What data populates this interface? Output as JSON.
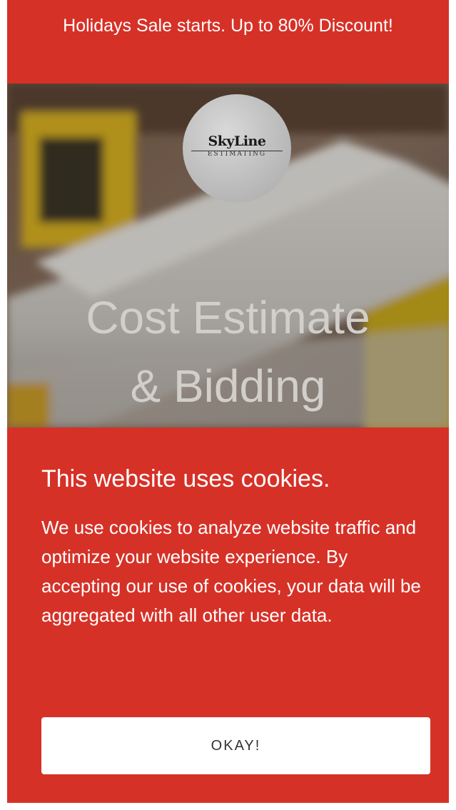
{
  "announcement": {
    "text": "Holidays Sale starts. Up to 80% Discount!"
  },
  "hero": {
    "logo": {
      "name": "SkyLine",
      "sub": "ESTIMATING"
    },
    "title_line1": "Cost Estimate",
    "title_line2": "& Bidding"
  },
  "cookie_banner": {
    "heading": "This website uses cookies.",
    "body": "We use cookies to analyze website traffic and optimize your website experience. By accepting our use of cookies, your data will be aggregated with all other user data.",
    "button_label": "OKAY!"
  },
  "colors": {
    "brand_red": "#d63127",
    "button_bg": "#ffffff",
    "hero_title": "#d2cfca"
  }
}
